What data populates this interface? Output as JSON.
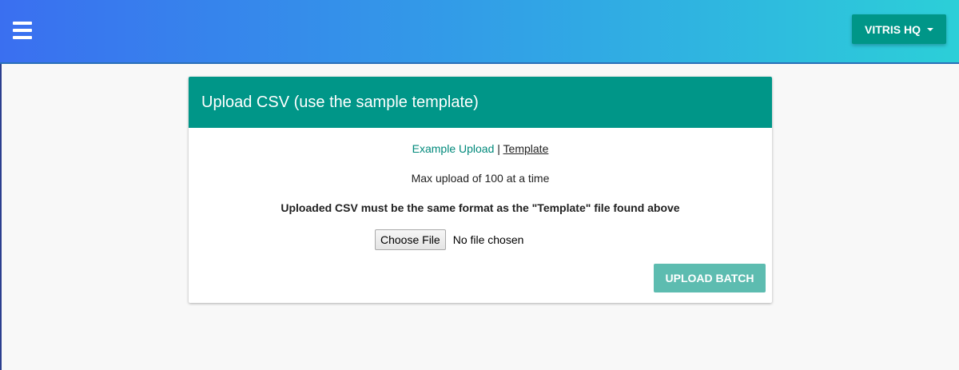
{
  "header": {
    "org_button_label": "VITRIS HQ"
  },
  "card": {
    "title": "Upload CSV (use the sample template)",
    "example_link": "Example Upload",
    "separator": "|",
    "template_link": "Template",
    "max_upload_text": "Max upload of 100 at a time",
    "format_note": "Uploaded CSV must be the same format as the \"Template\" file found above",
    "choose_file_label": "Choose File",
    "no_file_text": "No file chosen",
    "upload_button_label": "UPLOAD BATCH"
  },
  "colors": {
    "header_gradient_start": "#3a6ff0",
    "header_gradient_end": "#2ccfd8",
    "accent": "#009688",
    "upload_button_disabled": "#5dbcb0",
    "page_background": "#f8f8f8"
  },
  "icons": {
    "menu": "hamburger-menu-icon",
    "dropdown": "caret-down-icon"
  }
}
